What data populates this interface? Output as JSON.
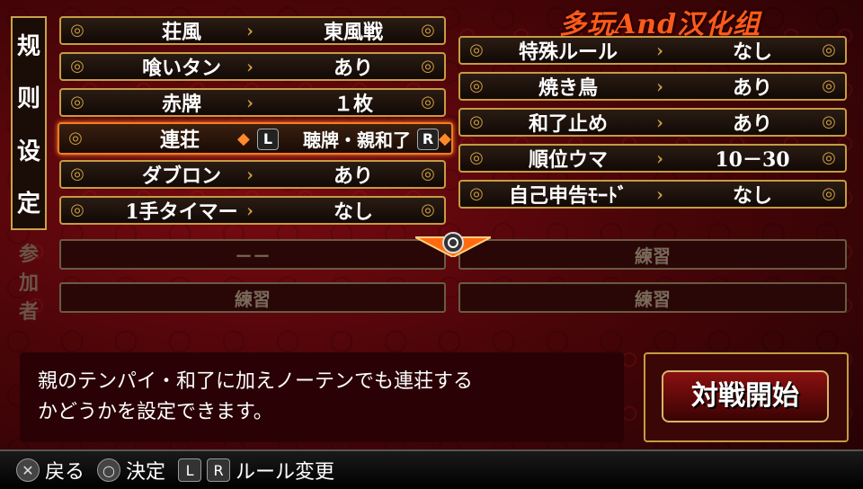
{
  "watermark": "多玩And汉化组",
  "rules_label": [
    "规",
    "则",
    "设",
    "定"
  ],
  "participants_label": [
    "参",
    "加",
    "者"
  ],
  "left_rules": [
    {
      "label": "荘風",
      "value": "東風戦"
    },
    {
      "label": "喰いタン",
      "value": "あり"
    },
    {
      "label": "赤牌",
      "value": "１枚"
    },
    {
      "label": "連荘",
      "value": "聴牌・親和了"
    },
    {
      "label": "ダブロン",
      "value": "あり"
    },
    {
      "label": "1手タイマー",
      "value": "なし"
    }
  ],
  "right_rules": [
    {
      "label": "特殊ルール",
      "value": "なし"
    },
    {
      "label": "焼き鳥",
      "value": "あり"
    },
    {
      "label": "和了止め",
      "value": "あり"
    },
    {
      "label": "順位ウマ",
      "value": "10－30"
    },
    {
      "label": "自己申告ﾓｰﾄﾞ",
      "value": "なし"
    }
  ],
  "selected_left_button": "L",
  "selected_right_button": "R",
  "participants": [
    "－－",
    "練習",
    "練習",
    "練習"
  ],
  "description": [
    "親のテンパイ・和了に加えノーテンでも連荘する",
    "かどうかを設定できます。"
  ],
  "start_button": "対戦開始",
  "footer": {
    "back_icon": "cross-icon",
    "back": "戻る",
    "confirm_icon": "circle-icon",
    "confirm": "決定",
    "l": "L",
    "r": "R",
    "rule_change": "ルール変更"
  },
  "colors": {
    "accent": "#c79b43",
    "selected": "#ff7a1a",
    "background": "#4a0508"
  }
}
